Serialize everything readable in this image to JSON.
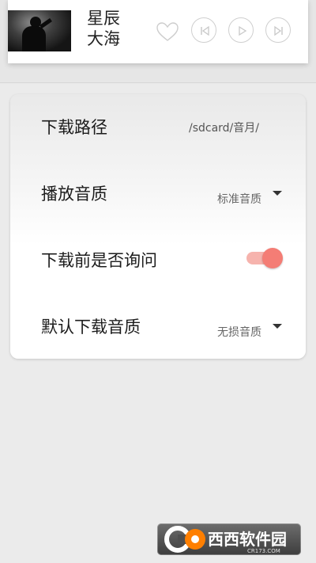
{
  "player": {
    "title_line1": "星辰",
    "title_line2": "大海",
    "icons": [
      "heart-icon",
      "previous-icon",
      "play-icon",
      "next-icon"
    ]
  },
  "settings": {
    "items": [
      {
        "label": "下载路径",
        "value": "/sdcard/音月/"
      },
      {
        "label": "播放音质",
        "value": "标准音质"
      },
      {
        "label": "下载前是否询问",
        "toggle": true
      },
      {
        "label": "默认下载音质",
        "value": "无损音质"
      }
    ]
  },
  "watermark": {
    "text": "西西软件园",
    "sub": "CR173.COM"
  },
  "colors": {
    "accent": "#f47d75",
    "accent_track": "#f6b3ad",
    "background": "#ebebeb"
  }
}
